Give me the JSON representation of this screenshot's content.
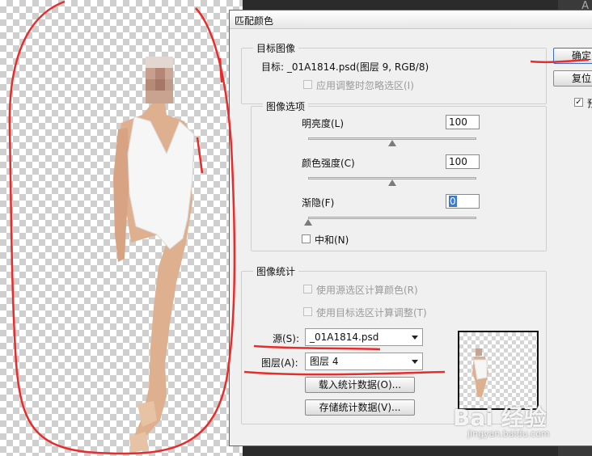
{
  "dialog": {
    "title": "匹配颜色",
    "ok_label": "确定",
    "reset_label": "复位",
    "preview_label": "预",
    "preview_checked": true
  },
  "target_image": {
    "legend": "目标图像",
    "target_text": "目标:  _01A1814.psd(图层 9, RGB/8)",
    "ignore_selection_label": "应用调整时忽略选区(I)"
  },
  "image_options": {
    "legend": "图像选项",
    "luminance_label": "明亮度(L)",
    "luminance_value": "100",
    "luminance_level": 0.5,
    "color_intensity_label": "颜色强度(C)",
    "color_intensity_value": "100",
    "color_intensity_level": 0.5,
    "fade_label": "渐隐(F)",
    "fade_value": "0",
    "fade_level": 0,
    "neutralize_label": "中和(N)"
  },
  "image_statistics": {
    "legend": "图像统计",
    "use_source_selection_label": "使用源选区计算颜色(R)",
    "use_target_selection_label": "使用目标选区计算调整(T)",
    "source_label": "源(S):",
    "source_value": "_01A1814.psd",
    "layer_label": "图层(A):",
    "layer_value": "图层 4",
    "load_stats_label": "载入统计数据(O)...",
    "save_stats_label": "存储统计数据(V)..."
  },
  "right_panel": {
    "letter": "A"
  },
  "watermark": {
    "brand": "Bai 经验",
    "url": "jingyan.baidu.com"
  }
}
